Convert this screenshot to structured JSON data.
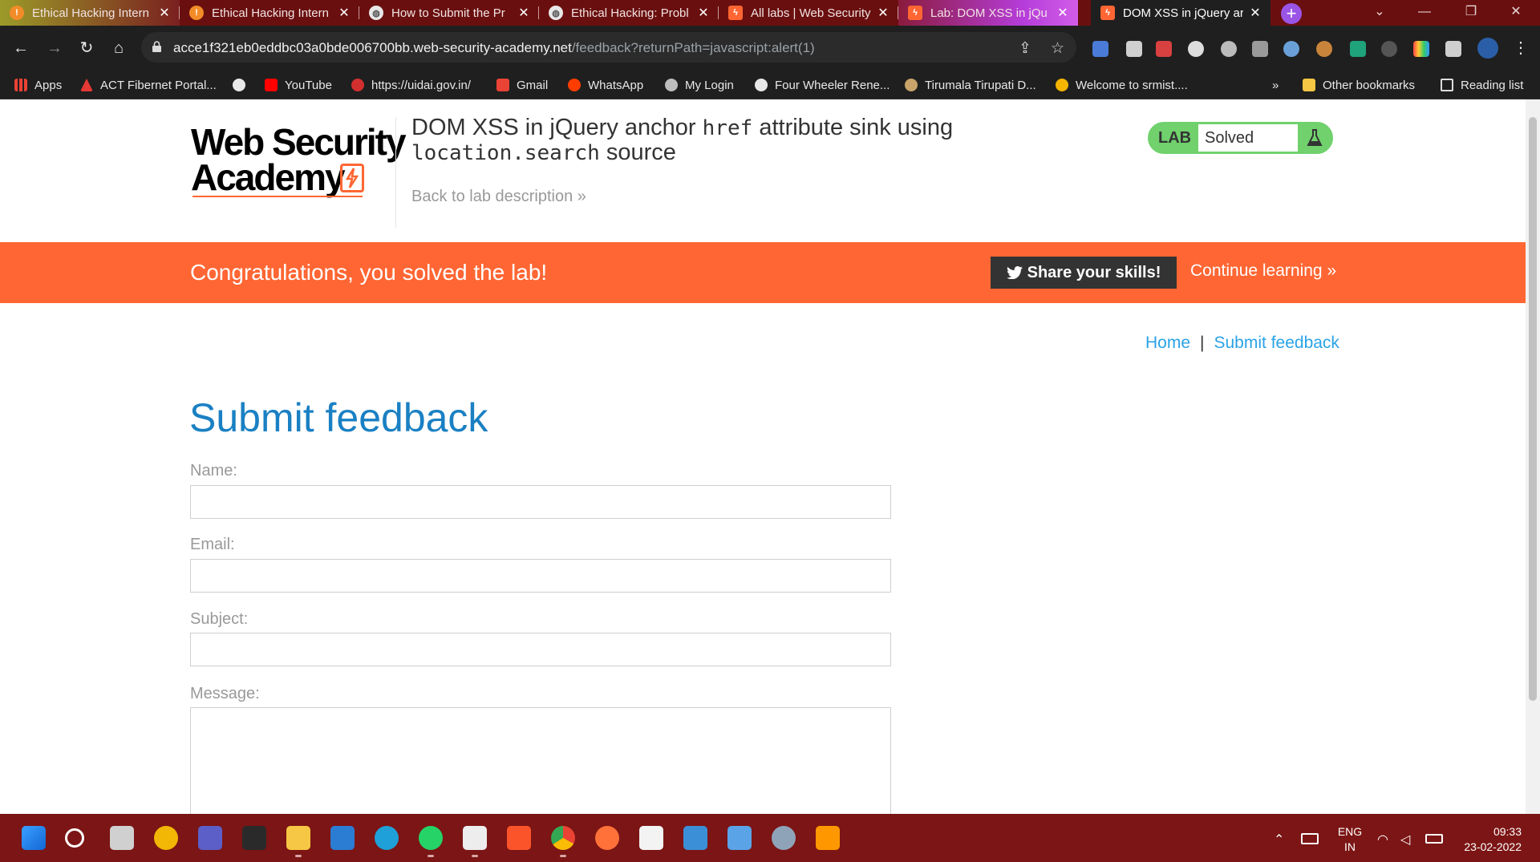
{
  "browser": {
    "tabs": [
      {
        "title": "Ethical Hacking Intern",
        "favicon": "orange-info-icon"
      },
      {
        "title": "Ethical Hacking Intern",
        "favicon": "orange-info-icon"
      },
      {
        "title": "How to Submit the Pr",
        "favicon": "globe-icon"
      },
      {
        "title": "Ethical Hacking: Probl",
        "favicon": "globe-icon"
      },
      {
        "title": "All labs | Web Security",
        "favicon": "portswigger-icon"
      },
      {
        "title": "Lab: DOM XSS in jQu",
        "favicon": "portswigger-icon"
      },
      {
        "title": "DOM XSS in jQuery ar",
        "favicon": "portswigger-icon"
      }
    ],
    "url_host": "acce1f321eb0eddbc03a0bde006700bb.web-security-academy.net",
    "url_path": "/feedback?returnPath=javascript:alert(1)",
    "bookmarks": [
      {
        "label": "Apps"
      },
      {
        "label": "ACT Fibernet Portal..."
      },
      {
        "label": ""
      },
      {
        "label": "YouTube"
      },
      {
        "label": "https://uidai.gov.in/"
      },
      {
        "label": "Gmail"
      },
      {
        "label": "WhatsApp"
      },
      {
        "label": "My Login"
      },
      {
        "label": "Four Wheeler Rene..."
      },
      {
        "label": "Tirumala Tirupati D..."
      },
      {
        "label": "Welcome to srmist...."
      }
    ],
    "bookmarks_overflow": "»",
    "other_bookmarks": "Other bookmarks",
    "reading_list": "Reading list"
  },
  "header": {
    "logo_line1": "Web Security",
    "logo_line2": "Academy",
    "lab_title": "DOM XSS in jQuery anchor",
    "lab_title_code1": "href",
    "lab_title_mid": "attribute sink using",
    "lab_title_code2": "location.search",
    "lab_title_end": "source",
    "back_link": "Back to lab description",
    "back_chevron": "»",
    "lab_badge_label": "LAB",
    "lab_status": "Solved"
  },
  "banner": {
    "message": "Congratulations, you solved the lab!",
    "share_label": "Share your skills!",
    "continue_label": "Continue learning",
    "continue_chevron": "»"
  },
  "breadcrumb": {
    "home": "Home",
    "separator": "|",
    "current": "Submit feedback"
  },
  "form": {
    "title": "Submit feedback",
    "name_label": "Name:",
    "email_label": "Email:",
    "subject_label": "Subject:",
    "message_label": "Message:"
  },
  "taskbar": {
    "lang_line1": "ENG",
    "lang_line2": "IN",
    "time": "09:33",
    "date": "23-02-2022"
  },
  "colors": {
    "accent_orange": "#ff6633",
    "title_blue": "#1a80c3",
    "link_blue": "#29a3e6",
    "solved_green": "#70d16d",
    "tabstrip": "#6a0f0f",
    "taskbar": "#7c1515"
  }
}
